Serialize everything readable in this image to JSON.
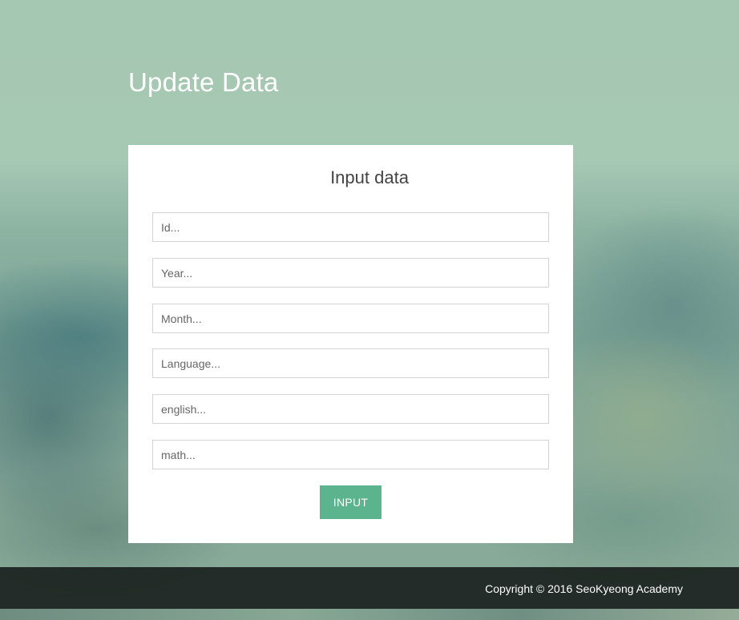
{
  "page": {
    "title": "Update Data"
  },
  "form": {
    "heading": "Input data",
    "fields": [
      {
        "name": "id",
        "placeholder": "Id..."
      },
      {
        "name": "year",
        "placeholder": "Year..."
      },
      {
        "name": "month",
        "placeholder": "Month..."
      },
      {
        "name": "language",
        "placeholder": "Language..."
      },
      {
        "name": "english",
        "placeholder": "english..."
      },
      {
        "name": "math",
        "placeholder": "math..."
      }
    ],
    "submit_label": "INPUT"
  },
  "footer": {
    "copyright": "Copyright © 2016 SeoKyeong Academy"
  },
  "colors": {
    "accent": "#5bb48e",
    "footer_bg": "#141a18"
  }
}
